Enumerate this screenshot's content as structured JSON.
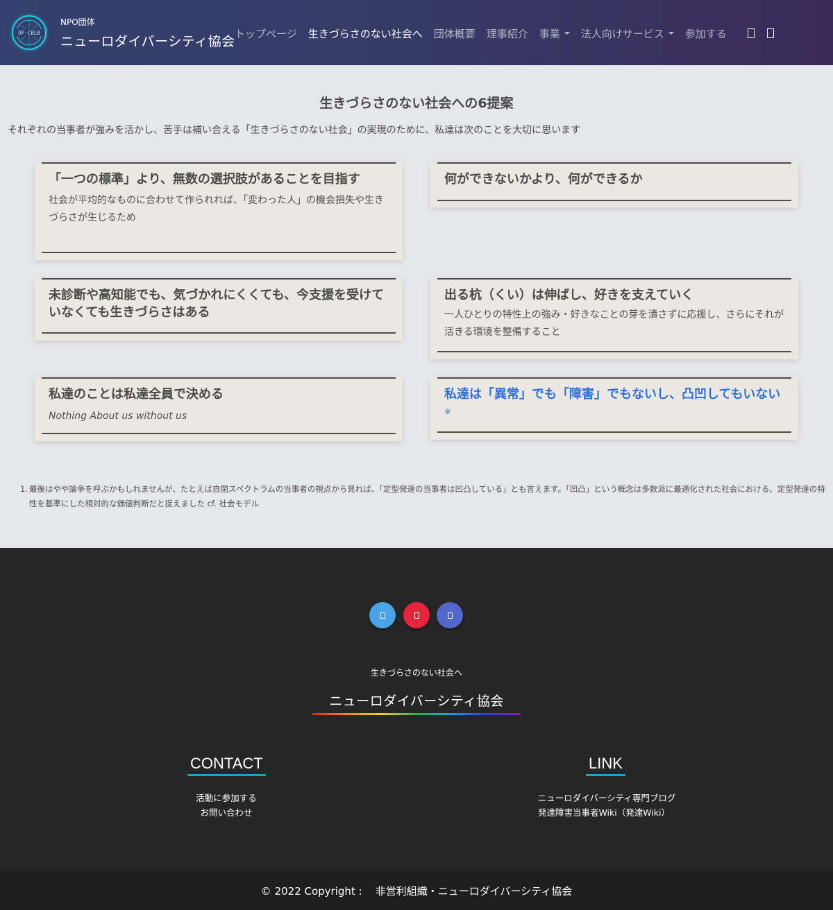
{
  "header": {
    "brand_sub": "NPO団体",
    "brand_title": "ニューロダイバーシティ協会",
    "logo_text": "DF-CBLB",
    "nav": [
      {
        "label": "トップページ",
        "active": false
      },
      {
        "label": "生きづらさのない社会へ",
        "active": true
      },
      {
        "label": "団体概要",
        "active": false
      },
      {
        "label": "理事紹介",
        "active": false
      },
      {
        "label": "事業",
        "active": false
      },
      {
        "label": "法人向けサービス",
        "active": false
      },
      {
        "label": "参加する",
        "active": false
      }
    ],
    "icons": [
      "search-icon",
      "menu-icon"
    ]
  },
  "main": {
    "title": "生きづらさのない社会への6提案",
    "lead": "それぞれの当事者が強みを活かし、苦手は補い合える「生きづらさのない社会」の実現のために、私達は次のことを大切に思います",
    "cards": [
      {
        "heading": "「一つの標準」より、無数の選択肢があることを目指す",
        "body": "社会が平均的なものに合わせて作られれば、「変わった人」の機会損失や生きづらさが生じるため"
      },
      {
        "heading": "何ができないかより、何ができるか",
        "body": ""
      },
      {
        "heading": "未診断や高知能でも、気づかれにくくても、今支援を受けていなくても生きづらさはある",
        "body": ""
      },
      {
        "heading": "出る杭（くい）は伸ばし、好きを支えていく",
        "body": "一人ひとりの特性上の強み・好きなことの芽を潰さずに応援し、さらにそれが活きる環境を整備すること"
      },
      {
        "heading": "私達のことは私達全員で決める",
        "body": "Nothing About us without us"
      },
      {
        "heading": "私達は「異常」でも「障害」でもないし、凸凹してもいない",
        "note_mark": "※"
      }
    ],
    "footnote_num": "1.",
    "footnote": "最後はやや論争を呼ぶかもしれませんが、たとえば自閉スペクトラムの当事者の視点から見れば、「定型発達の当事者は凹凸している」とも言えます。「凹凸」という概念は多数派に最適化された社会における、定型発達の特性を基準にした相対的な価値判断だと捉えました cf. 社会モデル"
  },
  "footer": {
    "social": [
      {
        "name": "twitter-icon",
        "color": "#4aa3e6"
      },
      {
        "name": "youtube-icon",
        "color": "#e5243b"
      },
      {
        "name": "facebook-icon",
        "color": "#5366c9"
      }
    ],
    "tagline": "生きづらさのない社会へ",
    "name": "ニューロダイバーシティ協会",
    "contact": {
      "title": "CONTACT",
      "links": [
        "活動に参加する",
        "お問い合わせ"
      ]
    },
    "link": {
      "title": "LINK",
      "links": [
        "ニューロダイバーシティ専門ブログ",
        "発達障害当事者Wiki（発達Wiki）"
      ]
    },
    "copyright": "© 2022 Copyright :    非営利組織・ニューロダイバーシティ協会"
  }
}
